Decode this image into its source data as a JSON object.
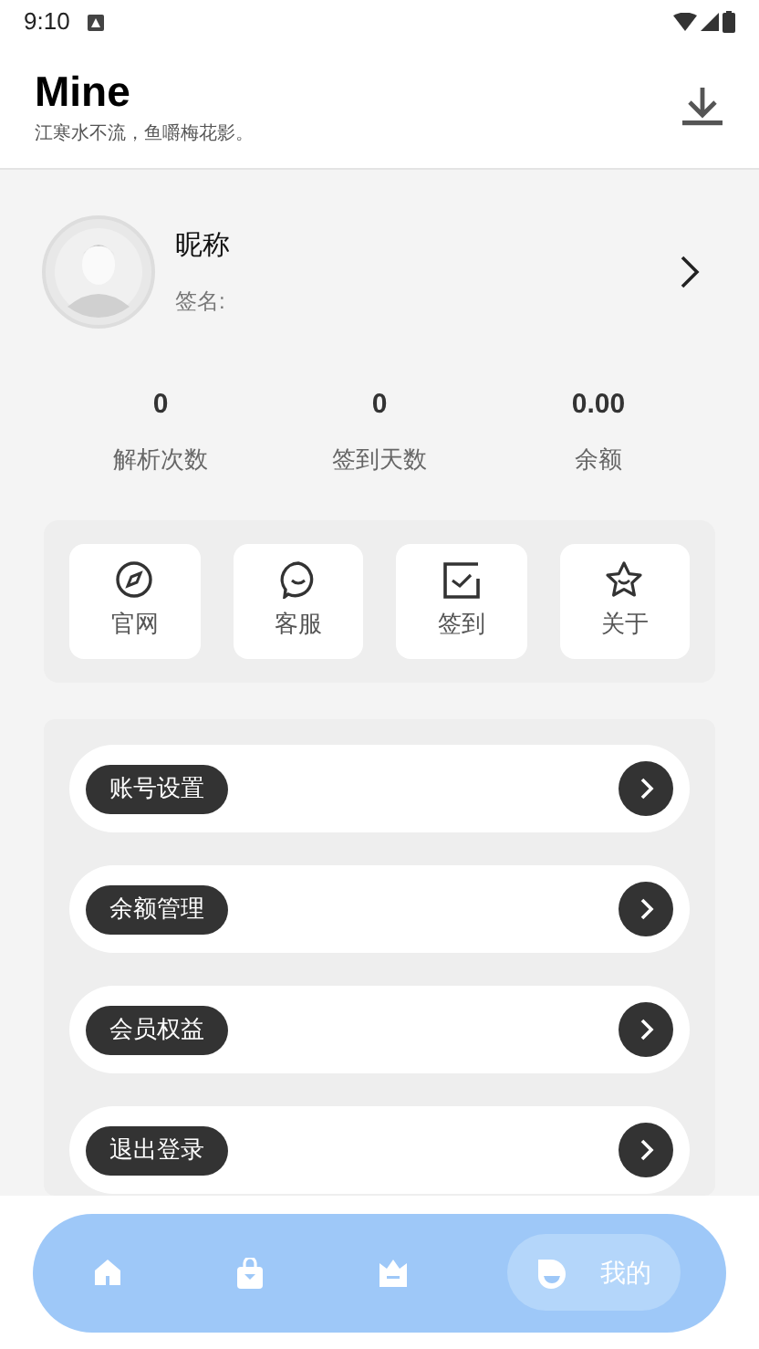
{
  "status_bar": {
    "time": "9:10"
  },
  "header": {
    "title": "Mine",
    "subtitle": "江寒水不流，鱼嚼梅花影。"
  },
  "profile": {
    "nickname": "昵称",
    "signature": "签名:"
  },
  "stats": [
    {
      "value": "0",
      "label": "解析次数"
    },
    {
      "value": "0",
      "label": "签到天数"
    },
    {
      "value": "0.00",
      "label": "余额"
    }
  ],
  "shortcuts": [
    {
      "kind": "compass",
      "label": "官网"
    },
    {
      "kind": "chat",
      "label": "客服"
    },
    {
      "kind": "checkin",
      "label": "签到"
    },
    {
      "kind": "star",
      "label": "关于"
    }
  ],
  "menu": [
    {
      "label": "账号设置"
    },
    {
      "label": "余额管理"
    },
    {
      "label": "会员权益"
    },
    {
      "label": "退出登录"
    }
  ],
  "bottom_nav": [
    {
      "kind": "home",
      "selected": false
    },
    {
      "kind": "bag",
      "selected": false
    },
    {
      "kind": "crown",
      "selected": false
    },
    {
      "kind": "profile",
      "selected": true,
      "label": "我的"
    }
  ]
}
